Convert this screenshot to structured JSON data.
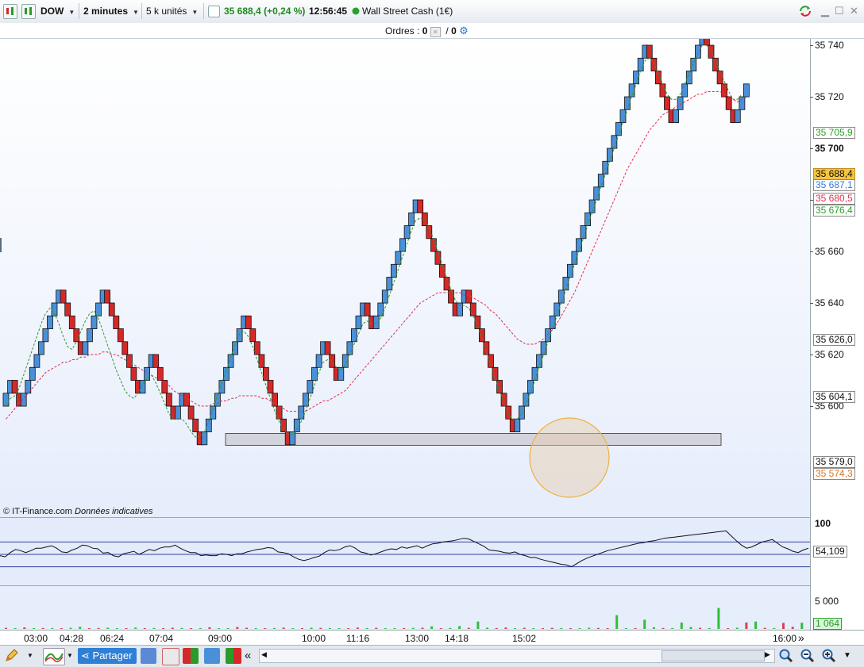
{
  "toolbar": {
    "symbol": "DOW",
    "timeframe": "2 minutes",
    "units": "5 k unités",
    "last_price": "35 688,4",
    "change": "(+0,24 %)",
    "time": "12:56:45",
    "instrument": "Wall Street Cash (1€)"
  },
  "orders": {
    "label": "Ordres :",
    "count1": "0",
    "slash": "/",
    "count2": "0"
  },
  "copyright": {
    "source": "© IT-Finance.com",
    "note": "Données indicatives"
  },
  "price_axis": {
    "ticks": [
      "35 740",
      "35 720",
      "35 700",
      "35 680",
      "35 660",
      "35 640",
      "35 620",
      "35 600"
    ],
    "labels": {
      "green_top": "35 705,9",
      "current": "35 688,4",
      "blue": "35 687,1",
      "red": "35 680,5",
      "green": "35 676,4",
      "level_626": "35 626,0",
      "level_604": "35 604,1",
      "level_579": "35 579,0",
      "level_574": "35 574,3"
    }
  },
  "rsi": {
    "max_label": "100",
    "value": "54,109",
    "values": [
      48,
      46,
      53,
      58,
      56,
      53,
      56,
      60,
      60,
      62,
      64,
      60,
      54,
      53,
      57,
      60,
      65,
      64,
      60,
      59,
      52,
      53,
      48,
      46,
      51,
      53,
      55,
      50,
      54,
      58,
      56,
      60,
      62,
      62,
      65,
      60,
      56,
      53,
      53,
      48,
      49,
      48,
      48,
      51,
      50,
      48,
      51,
      51,
      54,
      56,
      58,
      59,
      61,
      60,
      54,
      53,
      51,
      46,
      42,
      40,
      42,
      45,
      47,
      53,
      57,
      56,
      58,
      62,
      64,
      60,
      54,
      52,
      49,
      51,
      54,
      57,
      59,
      58,
      62,
      60,
      62,
      64,
      60,
      64,
      67,
      68,
      70,
      71,
      72,
      74,
      76,
      75,
      71,
      67,
      63,
      57,
      56,
      55,
      53,
      52,
      54,
      50,
      48,
      45,
      45,
      42,
      40,
      38,
      36,
      34,
      33,
      30,
      35,
      40,
      44,
      47,
      50,
      53,
      56,
      58,
      60,
      62,
      64,
      66,
      68,
      69,
      71,
      72,
      74,
      76,
      77,
      78,
      79,
      80,
      81,
      82,
      83,
      84,
      85,
      86,
      87,
      88,
      80,
      72,
      65,
      60,
      62,
      66,
      70,
      72,
      74,
      68,
      62,
      59,
      55,
      53,
      57,
      60
    ]
  },
  "volume": {
    "tick_label": "5 000",
    "value": "1 064",
    "bars": [
      {
        "v": 180,
        "c": "r"
      },
      {
        "v": 120,
        "c": "g"
      },
      {
        "v": 250,
        "c": "r"
      },
      {
        "v": 90,
        "c": "g"
      },
      {
        "v": 160,
        "c": "r"
      },
      {
        "v": 140,
        "c": "g"
      },
      {
        "v": 100,
        "c": "r"
      },
      {
        "v": 180,
        "c": "g"
      },
      {
        "v": 350,
        "c": "g"
      },
      {
        "v": 120,
        "c": "r"
      },
      {
        "v": 160,
        "c": "r"
      },
      {
        "v": 200,
        "c": "g"
      },
      {
        "v": 130,
        "c": "g"
      },
      {
        "v": 90,
        "c": "r"
      },
      {
        "v": 220,
        "c": "g"
      },
      {
        "v": 110,
        "c": "r"
      },
      {
        "v": 150,
        "c": "g"
      },
      {
        "v": 80,
        "c": "r"
      },
      {
        "v": 200,
        "c": "r"
      },
      {
        "v": 160,
        "c": "g"
      },
      {
        "v": 100,
        "c": "r"
      },
      {
        "v": 140,
        "c": "g"
      },
      {
        "v": 260,
        "c": "r"
      },
      {
        "v": 120,
        "c": "g"
      },
      {
        "v": 90,
        "c": "g"
      },
      {
        "v": 310,
        "c": "r"
      },
      {
        "v": 180,
        "c": "r"
      },
      {
        "v": 120,
        "c": "g"
      },
      {
        "v": 100,
        "c": "r"
      },
      {
        "v": 150,
        "c": "g"
      },
      {
        "v": 210,
        "c": "r"
      },
      {
        "v": 90,
        "c": "g"
      },
      {
        "v": 120,
        "c": "r"
      },
      {
        "v": 200,
        "c": "g"
      },
      {
        "v": 170,
        "c": "r"
      },
      {
        "v": 150,
        "c": "g"
      },
      {
        "v": 110,
        "c": "g"
      },
      {
        "v": 130,
        "c": "r"
      },
      {
        "v": 220,
        "c": "r"
      },
      {
        "v": 140,
        "c": "g"
      },
      {
        "v": 190,
        "c": "r"
      },
      {
        "v": 100,
        "c": "g"
      },
      {
        "v": 120,
        "c": "g"
      },
      {
        "v": 150,
        "c": "r"
      },
      {
        "v": 170,
        "c": "g"
      },
      {
        "v": 200,
        "c": "r"
      },
      {
        "v": 420,
        "c": "g"
      },
      {
        "v": 130,
        "c": "r"
      },
      {
        "v": 160,
        "c": "g"
      },
      {
        "v": 480,
        "c": "g"
      },
      {
        "v": 190,
        "c": "r"
      },
      {
        "v": 1220,
        "c": "g"
      },
      {
        "v": 210,
        "c": "g"
      },
      {
        "v": 140,
        "c": "r"
      },
      {
        "v": 220,
        "c": "r"
      },
      {
        "v": 120,
        "c": "g"
      },
      {
        "v": 180,
        "c": "r"
      },
      {
        "v": 130,
        "c": "g"
      },
      {
        "v": 90,
        "c": "r"
      },
      {
        "v": 180,
        "c": "r"
      },
      {
        "v": 150,
        "c": "g"
      },
      {
        "v": 100,
        "c": "r"
      },
      {
        "v": 120,
        "c": "g"
      },
      {
        "v": 200,
        "c": "g"
      },
      {
        "v": 160,
        "c": "r"
      },
      {
        "v": 90,
        "c": "r"
      },
      {
        "v": 2280,
        "c": "g"
      },
      {
        "v": 120,
        "c": "g"
      },
      {
        "v": 140,
        "c": "r"
      },
      {
        "v": 1530,
        "c": "g"
      },
      {
        "v": 280,
        "c": "g"
      },
      {
        "v": 160,
        "c": "r"
      },
      {
        "v": 150,
        "c": "g"
      },
      {
        "v": 1060,
        "c": "g"
      },
      {
        "v": 320,
        "c": "g"
      },
      {
        "v": 180,
        "c": "r"
      },
      {
        "v": 140,
        "c": "g"
      },
      {
        "v": 3480,
        "c": "g"
      },
      {
        "v": 120,
        "c": "r"
      },
      {
        "v": 200,
        "c": "g"
      },
      {
        "v": 1070,
        "c": "r"
      },
      {
        "v": 1230,
        "c": "g"
      },
      {
        "v": 180,
        "c": "r"
      },
      {
        "v": 150,
        "c": "g"
      },
      {
        "v": 1000,
        "c": "r"
      },
      {
        "v": 340,
        "c": "r"
      },
      {
        "v": 1020,
        "c": "g"
      }
    ]
  },
  "time_axis": {
    "labels": [
      "03:00",
      "04:28",
      "06:24",
      "07:04",
      "09:00",
      "10:00",
      "11:16",
      "13:00",
      "14:18",
      "15:02",
      "16:00"
    ]
  },
  "bottom_toolbar": {
    "share_label": "Partager"
  },
  "colors": {
    "up_brick": "#4a90d9",
    "down_brick": "#d62828",
    "fast_ma": "#2a9a2a",
    "slow_ma": "#e0304e",
    "price_green": "#1e8a1e",
    "current_bg": "#f6c342",
    "zone_fill": "#d3d3dc",
    "circle_stroke": "#f0b040"
  },
  "chart_data": {
    "type": "renko",
    "brick_size": 5,
    "timeframe": "2 minutes",
    "ylim": [
      35565,
      35745
    ],
    "brick_values": [
      35605,
      35610,
      35605,
      35600,
      35605,
      35610,
      35615,
      35620,
      35625,
      35630,
      35635,
      35640,
      35645,
      35640,
      35635,
      35630,
      35625,
      35620,
      35625,
      35630,
      35635,
      35640,
      35645,
      35640,
      35635,
      35630,
      35625,
      35620,
      35615,
      35610,
      35605,
      35610,
      35615,
      35620,
      35615,
      35610,
      35605,
      35600,
      35595,
      35600,
      35605,
      35600,
      35595,
      35590,
      35585,
      35590,
      35595,
      35600,
      35605,
      35610,
      35615,
      35620,
      35625,
      35630,
      35635,
      35630,
      35625,
      35620,
      35615,
      35610,
      35605,
      35600,
      35595,
      35590,
      35585,
      35590,
      35595,
      35600,
      35605,
      35610,
      35615,
      35620,
      35625,
      35620,
      35615,
      35610,
      35615,
      35620,
      35625,
      35630,
      35635,
      35640,
      35635,
      35630,
      35635,
      35640,
      35645,
      35650,
      35655,
      35660,
      35665,
      35670,
      35675,
      35680,
      35675,
      35670,
      35665,
      35660,
      35655,
      35650,
      35645,
      35640,
      35635,
      35640,
      35645,
      35640,
      35635,
      35630,
      35625,
      35620,
      35615,
      35610,
      35605,
      35600,
      35595,
      35590,
      35595,
      35600,
      35605,
      35610,
      35615,
      35620,
      35625,
      35630,
      35635,
      35640,
      35645,
      35650,
      35655,
      35660,
      35665,
      35670,
      35675,
      35680,
      35685,
      35690,
      35695,
      35700,
      35705,
      35710,
      35715,
      35720,
      35725,
      35730,
      35735,
      35740,
      35735,
      35730,
      35725,
      35720,
      35715,
      35710,
      35715,
      35720,
      35725,
      35730,
      35735,
      35740,
      35745,
      35740,
      35735,
      35730,
      35725,
      35720,
      35715,
      35710,
      35715,
      35720,
      35725
    ],
    "fast_ma": [
      35600,
      35603,
      35604,
      35607,
      35612,
      35617,
      35622,
      35627,
      35632,
      35636,
      35638,
      35636,
      35632,
      35627,
      35623,
      35622,
      35625,
      35629,
      35633,
      35636,
      35637,
      35634,
      35629,
      35624,
      35619,
      35614,
      35610,
      35606,
      35604,
      35603,
      35605,
      35608,
      35611,
      35612,
      35609,
      35605,
      35601,
      35597,
      35595,
      35595,
      35595,
      35593,
      35590,
      35588,
      35588,
      35590,
      35594,
      35599,
      35604,
      35609,
      35614,
      35619,
      35624,
      35628,
      35629,
      35627,
      35623,
      35618,
      35613,
      35608,
      35603,
      35598,
      35594,
      35591,
      35589,
      35589,
      35591,
      35594,
      35598,
      35603,
      35608,
      35613,
      35617,
      35618,
      35617,
      35615,
      35614,
      35616,
      35620,
      35624,
      35628,
      35632,
      35633,
      35632,
      35632,
      35634,
      35638,
      35643,
      35648,
      35653,
      35658,
      35663,
      35668,
      35672,
      35673,
      35672,
      35669,
      35665,
      35660,
      35655,
      35650,
      35645,
      35641,
      35639,
      35639,
      35638,
      35635,
      35631,
      35626,
      35621,
      35616,
      35611,
      35606,
      35601,
      35597,
      35595,
      35595,
      35597,
      35601,
      35605,
      35610,
      35615,
      35620,
      35625,
      35630,
      35635,
      35640,
      35645,
      35650,
      35655,
      35660,
      35665,
      35670,
      35675,
      35680,
      35685,
      35690,
      35695,
      35700,
      35705,
      35710,
      35715,
      35720,
      35725,
      35730,
      35734,
      35735,
      35733,
      35729,
      35725,
      35721,
      35719,
      35719,
      35721,
      35725,
      35729,
      35733,
      35737,
      35740,
      35740,
      35738,
      35734,
      35730,
      35726,
      35722,
      35719,
      35719,
      35721
    ],
    "slow_ma": [
      35595,
      35597,
      35599,
      35601,
      35603,
      35605,
      35607,
      35609,
      35611,
      35613,
      35614,
      35615,
      35616,
      35617,
      35617,
      35618,
      35618,
      35619,
      35619,
      35620,
      35620,
      35620,
      35621,
      35621,
      35620,
      35620,
      35619,
      35618,
      35617,
      35616,
      35615,
      35614,
      35613,
      35612,
      35611,
      35610,
      35609,
      35608,
      35606,
      35605,
      35604,
      35603,
      35602,
      35601,
      35600,
      35600,
      35600,
      35601,
      35601,
      35602,
      35602,
      35603,
      35603,
      35604,
      35604,
      35604,
      35604,
      35604,
      35603,
      35603,
      35602,
      35601,
      35600,
      35599,
      35598,
      35598,
      35598,
      35598,
      35598,
      35599,
      35600,
      35601,
      35602,
      35602,
      35603,
      35604,
      35605,
      35606,
      35608,
      35610,
      35612,
      35614,
      35616,
      35618,
      35620,
      35622,
      35624,
      35626,
      35628,
      35630,
      35632,
      35634,
      35636,
      35638,
      35640,
      35641,
      35642,
      35643,
      35644,
      35644,
      35644,
      35644,
      35644,
      35644,
      35643,
      35643,
      35642,
      35641,
      35640,
      35639,
      35637,
      35636,
      35634,
      35632,
      35630,
      35628,
      35626,
      35625,
      35624,
      35624,
      35624,
      35625,
      35626,
      35628,
      35630,
      35632,
      35635,
      35638,
      35641,
      35644,
      35648,
      35652,
      35656,
      35660,
      35664,
      35668,
      35672,
      35676,
      35680,
      35684,
      35688,
      35692,
      35695,
      35698,
      35701,
      35704,
      35707,
      35709,
      35711,
      35713,
      35714,
      35715,
      35716,
      35717,
      35718,
      35719,
      35720,
      35721,
      35721,
      35722,
      35722,
      35722,
      35722,
      35721,
      35720,
      35719,
      35718,
      35719,
      35720
    ]
  }
}
